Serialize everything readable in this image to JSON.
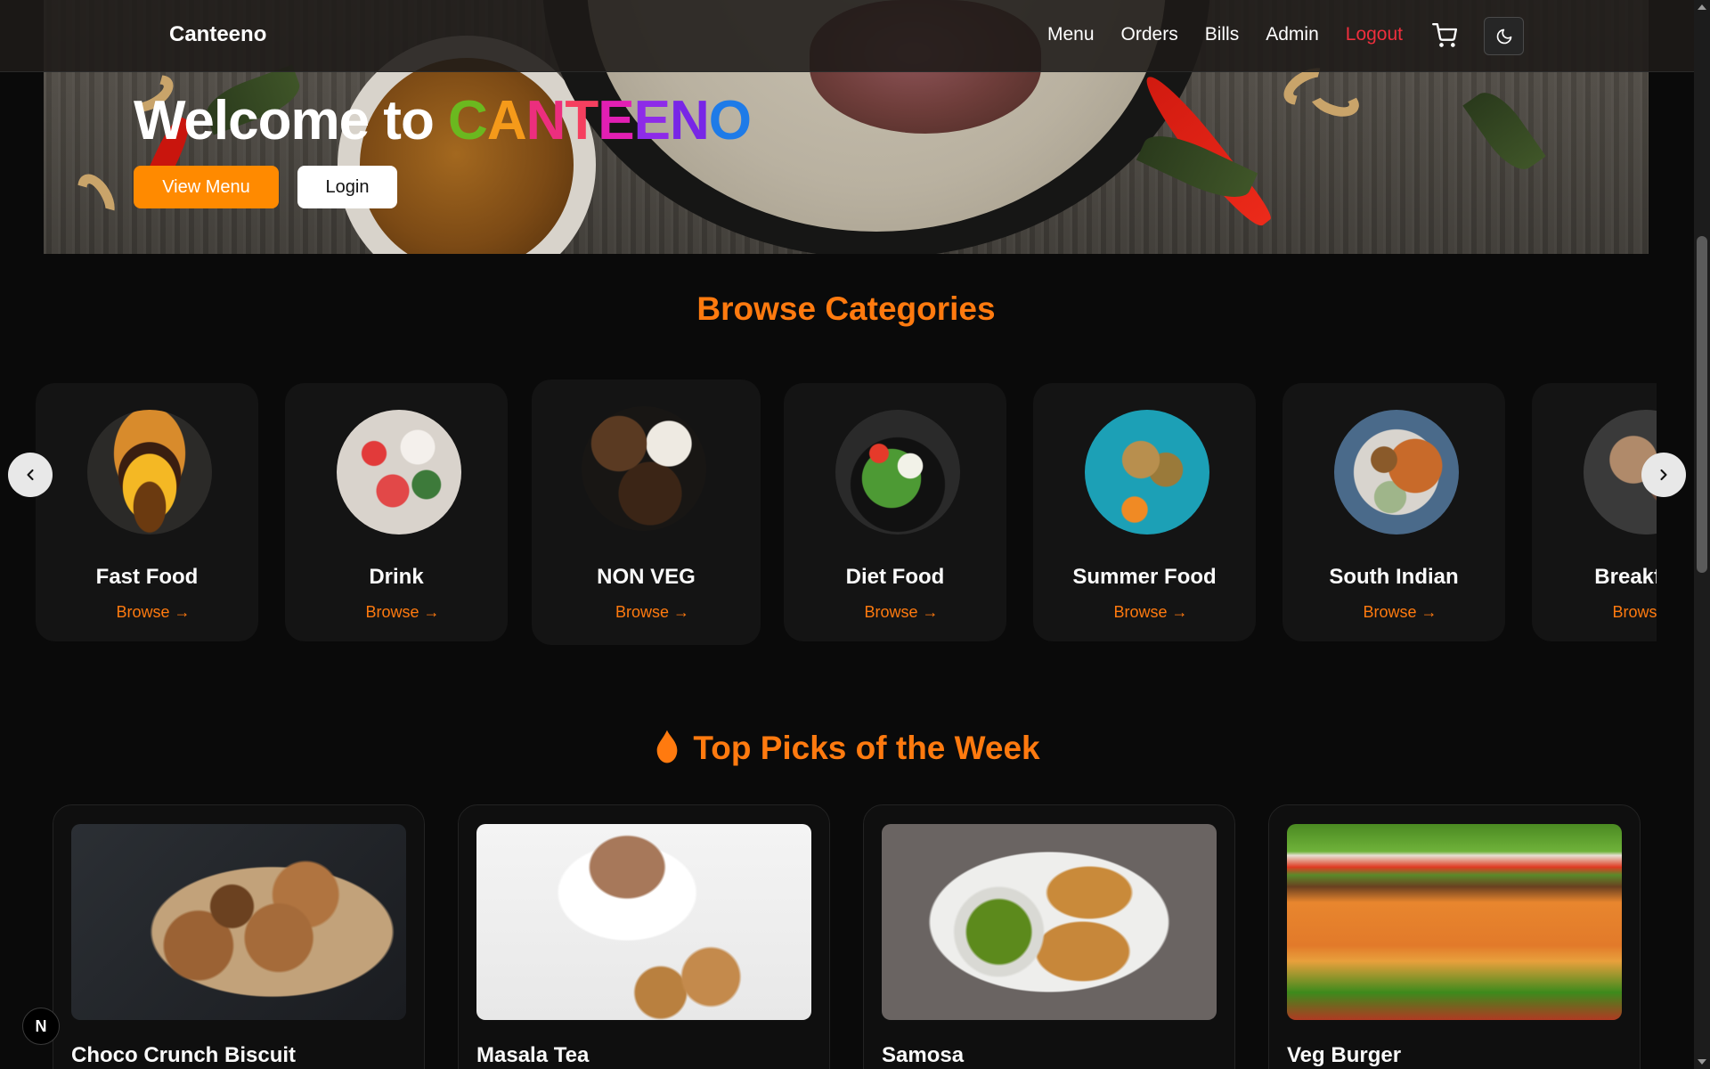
{
  "brand": "Canteeno",
  "nav": {
    "links": [
      "Menu",
      "Orders",
      "Bills",
      "Admin",
      "Logout"
    ],
    "cart_icon": "shopping-cart-icon",
    "theme_icon": "moon-icon"
  },
  "hero": {
    "title_prefix": "Welcome to",
    "brand_letters": [
      "C",
      "A",
      "N",
      "T",
      "E",
      "E",
      "N",
      "O"
    ],
    "brand_colors": [
      "#6bb81f",
      "#f59a1a",
      "#ec2e7e",
      "#f53f5f",
      "#e21fb3",
      "#8d2be8",
      "#7826e6",
      "#1e7be8"
    ],
    "view_menu": "View Menu",
    "login": "Login"
  },
  "categories": {
    "title": "Browse Categories",
    "items": [
      {
        "name": "Fast Food",
        "browse": "Browse →"
      },
      {
        "name": "Drink",
        "browse": "Browse →"
      },
      {
        "name": "NON VEG",
        "browse": "Browse →"
      },
      {
        "name": "Diet Food",
        "browse": "Browse →"
      },
      {
        "name": "Summer Food",
        "browse": "Browse →"
      },
      {
        "name": "South Indian",
        "browse": "Browse →"
      },
      {
        "name": "Breakfast",
        "browse": "Browse →"
      }
    ]
  },
  "top_picks": {
    "title": "Top Picks of the Week",
    "icon": "flame-icon",
    "items": [
      {
        "name": "Choco Crunch Biscuit"
      },
      {
        "name": "Masala Tea"
      },
      {
        "name": "Samosa"
      },
      {
        "name": "Veg Burger"
      }
    ]
  },
  "badge": "N",
  "colors": {
    "accent": "#ff7a0f",
    "button": "#ff8a00",
    "logout": "#ef2f3d",
    "background": "#0a0a0a",
    "card": "#141414"
  }
}
